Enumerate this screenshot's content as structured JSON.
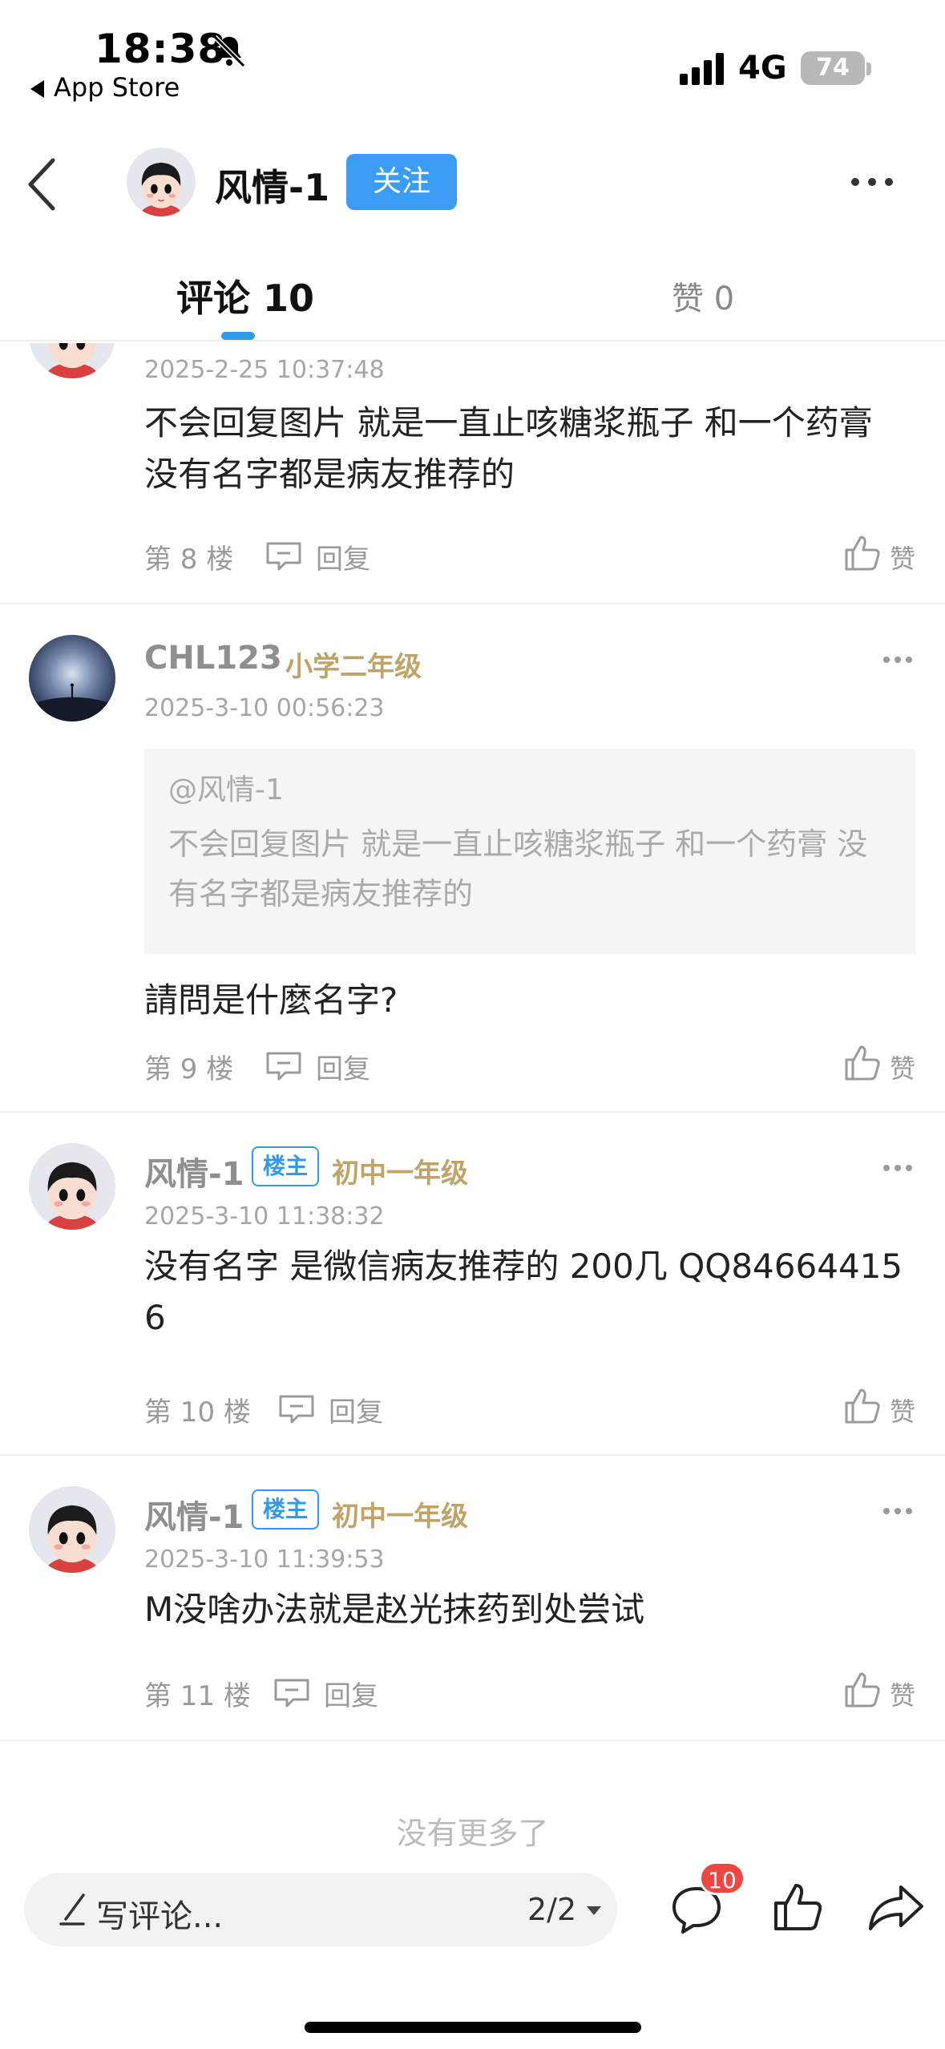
{
  "status_bar": {
    "time": "18:38",
    "back_app": "App Store",
    "network": "4G",
    "battery": "74"
  },
  "header": {
    "name": "风情-1",
    "follow_label": "关注"
  },
  "tabs": {
    "comments": "评论 10",
    "likes": "赞 0"
  },
  "comments": [
    {
      "time": "2025-2-25 10:37:48",
      "text": "不会回复图片 就是一直止咳糖浆瓶子 和一个药膏 没有名字都是病友推荐的",
      "floor": "第 8 楼",
      "reply_label": "回复",
      "like_label": "赞"
    },
    {
      "username": "CHL123",
      "level": "小学二年级",
      "time": "2025-3-10 00:56:23",
      "quote_at": "@风情-1",
      "quote_text": "不会回复图片 就是一直止咳糖浆瓶子 和一个药膏 没有名字都是病友推荐的",
      "text": "請問是什麼名字?",
      "floor": "第 9 楼",
      "reply_label": "回复",
      "like_label": "赞"
    },
    {
      "username": "风情-1",
      "badge": "楼主",
      "level": "初中一年级",
      "time": "2025-3-10 11:38:32",
      "text": "没有名字 是微信病友推荐的 200几 QQ846644156",
      "floor": "第 10 楼",
      "reply_label": "回复",
      "like_label": "赞"
    },
    {
      "username": "风情-1",
      "badge": "楼主",
      "level": "初中一年级",
      "time": "2025-3-10 11:39:53",
      "text": "M没啥办法就是赵光抹药到处尝试",
      "floor": "第 11 楼",
      "reply_label": "回复",
      "like_label": "赞"
    }
  ],
  "no_more": "没有更多了",
  "bottom_bar": {
    "input_placeholder": "写评论...",
    "page_indicator": "2/2",
    "comment_badge": "10"
  },
  "colors": {
    "accent": "#2f9bf0",
    "follow_bg": "#3a9df3",
    "level": "#c0a366",
    "badge_red": "#f04641"
  }
}
